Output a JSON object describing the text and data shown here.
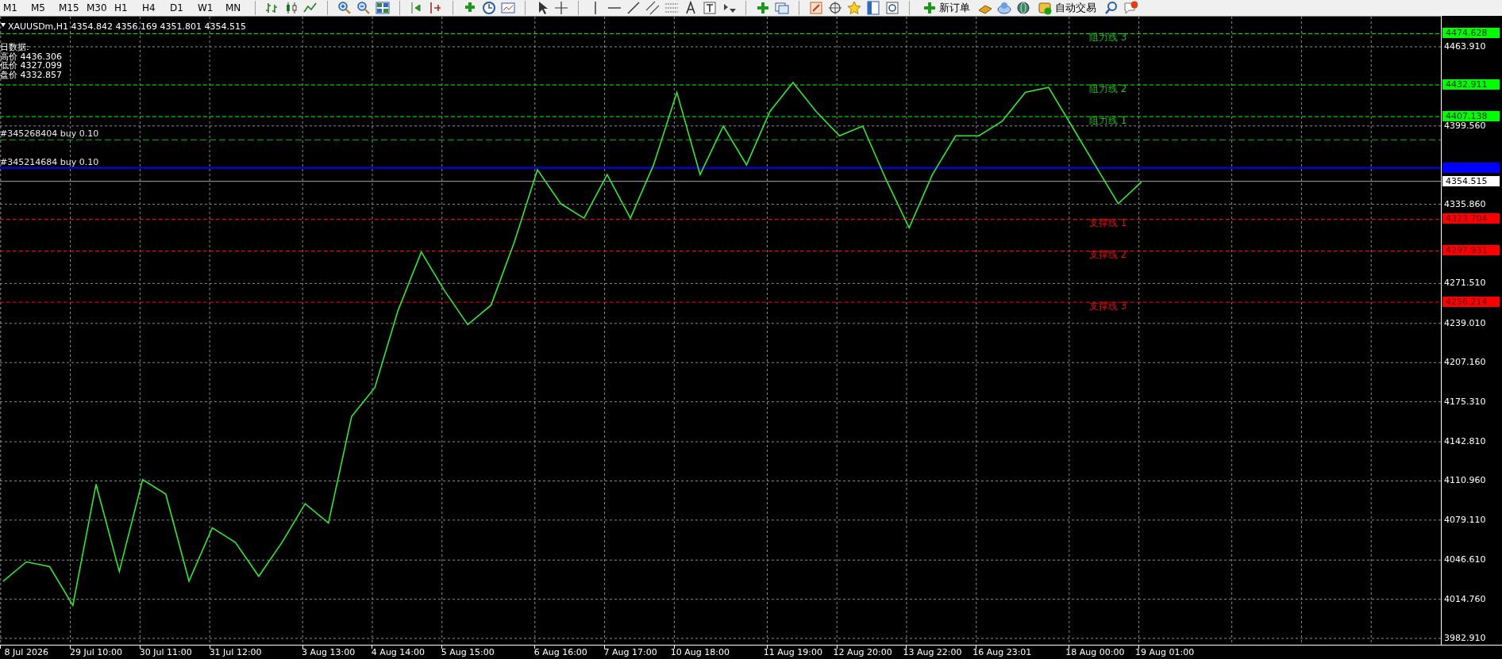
{
  "toolbar": {
    "periods": [
      "M1",
      "M5",
      "M15",
      "M30",
      "H1",
      "H4",
      "D1",
      "W1",
      "MN"
    ],
    "buttons": [
      {
        "label": "新订单"
      },
      {
        "label": "自动交易"
      }
    ]
  },
  "chart": {
    "ohlc": "4354.842 4356.169 4351.801 4354.515",
    "info_lines": [
      "日数据:",
      "高价 4436.306",
      "低价 4327.099",
      "盘价 4332.857"
    ],
    "levels": [
      {
        "kind": "resistance",
        "label": "阻力线 3",
        "price": "4474.628"
      },
      {
        "kind": "resistance",
        "label": "阻力线 2",
        "price": "4432.911"
      },
      {
        "kind": "resistance",
        "label": "阻力线 1",
        "price": "4407.138"
      },
      {
        "kind": "order",
        "label": "#345268404 buy 0.10"
      },
      {
        "kind": "order",
        "label": "#345214684 buy 0.10"
      },
      {
        "kind": "bid",
        "price": "4354.515"
      },
      {
        "kind": "support",
        "label": "支撑线 1",
        "price": "4323.704"
      },
      {
        "kind": "support",
        "label": "支撑线 2",
        "price": "4297.931"
      },
      {
        "kind": "support",
        "label": "支撑线 3",
        "price": "4256.214"
      }
    ],
    "chart_data": {
      "type": "line",
      "grid": true,
      "categories": [
        null,
        "8 Jul 2026",
        null,
        null,
        "29 Jul 10:00",
        null,
        null,
        "30 Jul 11:00",
        null,
        null,
        "31 Jul 12:00",
        null,
        null,
        null,
        "3 Aug 13:00",
        null,
        null,
        "4 Aug 14:00",
        null,
        null,
        "5 Aug 15:00",
        null,
        null,
        null,
        "6 Aug 16:00",
        null,
        null,
        "7 Aug 17:00",
        null,
        null,
        "10 Aug 18:00",
        null,
        null,
        null,
        "11 Aug 19:00",
        null,
        null,
        "12 Aug 20:00",
        null,
        null,
        "13 Aug 22:00",
        null,
        null,
        "16 Aug 23:01",
        null,
        null,
        null,
        "18 Aug 00:00",
        null,
        null,
        "19 Aug 01:00",
        null,
        null,
        null,
        null,
        null,
        null,
        null,
        null,
        null,
        null,
        null
      ],
      "series": [
        {
          "name": "XAUUSDm,H1",
          "color": "#32e832",
          "values": [
            4029.5,
            4045.2,
            4041.3,
            4009.8,
            4108.2,
            4037.4,
            4112.1,
            4100.3,
            4029.5,
            4072.8,
            4060.9,
            4033.4,
            4060.9,
            4092.4,
            4076.7,
            4163.3,
            4186.9,
            4249.8,
            4297.0,
            4265.6,
            4238.0,
            4253.8,
            4304.9,
            4364.0,
            4336.4,
            4324.6,
            4360.0,
            4324.6,
            4367.9,
            4426.9,
            4360.0,
            4399.4,
            4367.9,
            4411.2,
            4434.8,
            4411.2,
            4391.5,
            4399.4,
            4356.1,
            4316.7,
            4360.0,
            4391.5,
            4391.5,
            4403.3,
            4426.9,
            4430.9,
            4399.4,
            4367.9,
            4336.4,
            4354.1,
            null,
            null,
            null,
            null,
            null,
            null,
            null,
            null,
            null,
            null,
            null,
            null
          ]
        }
      ],
      "ylim": [
        3977.8,
        4488.4
      ],
      "yticks": [
        {
          "value": 4463.91,
          "label": "4463.910"
        },
        {
          "value": 4399.56,
          "label": "4399.560"
        },
        {
          "value": 4335.86,
          "label": "4335.860"
        },
        {
          "value": 4271.51,
          "label": "4271.510"
        },
        {
          "value": 4239.01,
          "label": "4239.010"
        },
        {
          "value": 4207.16,
          "label": "4207.160"
        },
        {
          "value": 4175.31,
          "label": "4175.310"
        },
        {
          "value": 4142.81,
          "label": "4142.810"
        },
        {
          "value": 4110.96,
          "label": "4110.960"
        },
        {
          "value": 4079.11,
          "label": "4079.110"
        },
        {
          "value": 4046.61,
          "label": "4046.610"
        },
        {
          "value": 4014.76,
          "label": "4014.760"
        },
        {
          "value": 3982.91,
          "label": "3982.910"
        }
      ],
      "ref_lines": [
        {
          "axis": "y",
          "value": 4474.628,
          "color": "#00ff00"
        },
        {
          "axis": "y",
          "value": 4432.911,
          "color": "#00ff00"
        },
        {
          "axis": "y",
          "value": 4407.138,
          "color": "#00ff00"
        },
        {
          "axis": "y",
          "value": 4388.3,
          "color": "#00c000"
        },
        {
          "axis": "y",
          "value": 4365.5,
          "color": "#0000ff"
        },
        {
          "axis": "y",
          "value": 4354.515,
          "color": "#a8a8a8"
        },
        {
          "axis": "y",
          "value": 4323.704,
          "color": "#ff0000"
        },
        {
          "axis": "y",
          "value": 4297.931,
          "color": "#ff0000"
        },
        {
          "axis": "y",
          "value": 4256.214,
          "color": "#ff0000"
        }
      ]
    }
  }
}
